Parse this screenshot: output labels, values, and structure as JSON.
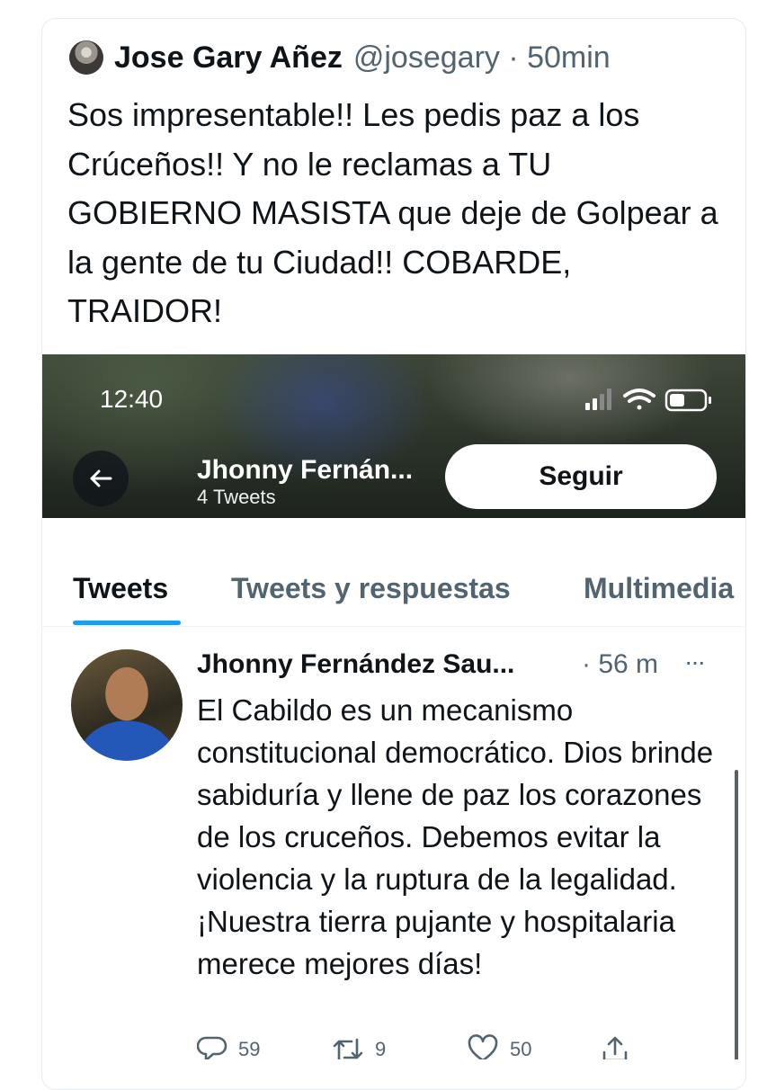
{
  "outer_tweet": {
    "name": "Jose Gary Añez",
    "handle_time": "@josegary · 50min",
    "text": "Sos impresentable!! Les pedis paz a los Crúceños!! Y no le reclamas a TU GOBIERNO MASISTA que deje de Golpear a la gente de tu Ciudad!! COBARDE, TRAIDOR!"
  },
  "screenshot": {
    "status_time": "12:40",
    "profile_name": "Jhonny Fernán...",
    "tweet_count": "4 Tweets",
    "follow_label": "Seguir",
    "tabs": [
      "Tweets",
      "Tweets y respuestas",
      "Multimedia"
    ],
    "tweet": {
      "name": "Jhonny Fernández Sau...",
      "time": "· 56 m",
      "more": "···",
      "text": "El Cabildo es un mecanismo constitucional democrático. Dios brinde sabiduría y llene de paz los corazones de los cruceños. Debemos evitar la violencia y la ruptura de la legalidad. ¡Nuestra tierra pujante y hospitalaria merece mejores días!",
      "replies": "59",
      "retweets": "9",
      "likes": "50"
    }
  }
}
